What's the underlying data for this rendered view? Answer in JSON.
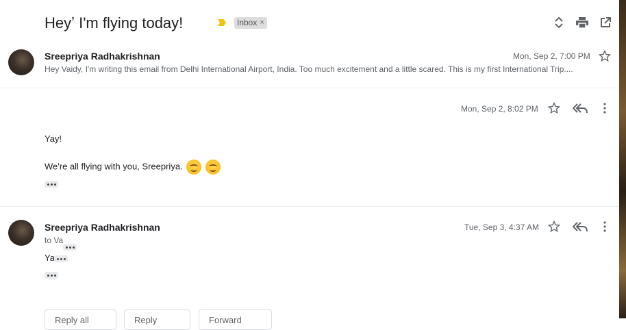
{
  "thread": {
    "subject": "Heyʼ        I'm flying today!",
    "label_chip": "Inbox",
    "label_remove": "×"
  },
  "header_icons": [
    "expand-collapse-icon",
    "print-icon",
    "open-in-new-window-icon"
  ],
  "messages": [
    {
      "sender": "Sreepriya Radhakrishnan",
      "date": "Mon, Sep 2, 7:00 PM",
      "snippet": "Hey Vaidy, I'm writing this email from Delhi International Airport, India. Too much excitement and a little scared. This is my first International Trip...."
    },
    {
      "sender": "",
      "date": "Mon, Sep 2, 8:02 PM",
      "body_line1": "Yay!",
      "body_line2": "We're all flying with you, Sreepriya."
    },
    {
      "sender": "Sreepriya Radhakrishnan",
      "date": "Tue, Sep 3, 4:37 AM",
      "to_line": "to Va",
      "body_line1": "Ya"
    }
  ],
  "actions": {
    "reply_all": "Reply all",
    "reply": "Reply",
    "forward": "Forward"
  },
  "colors": {
    "importance_marker": "#f4c20d",
    "chip_background": "#dddddd",
    "emoji": "#f6b60e"
  }
}
